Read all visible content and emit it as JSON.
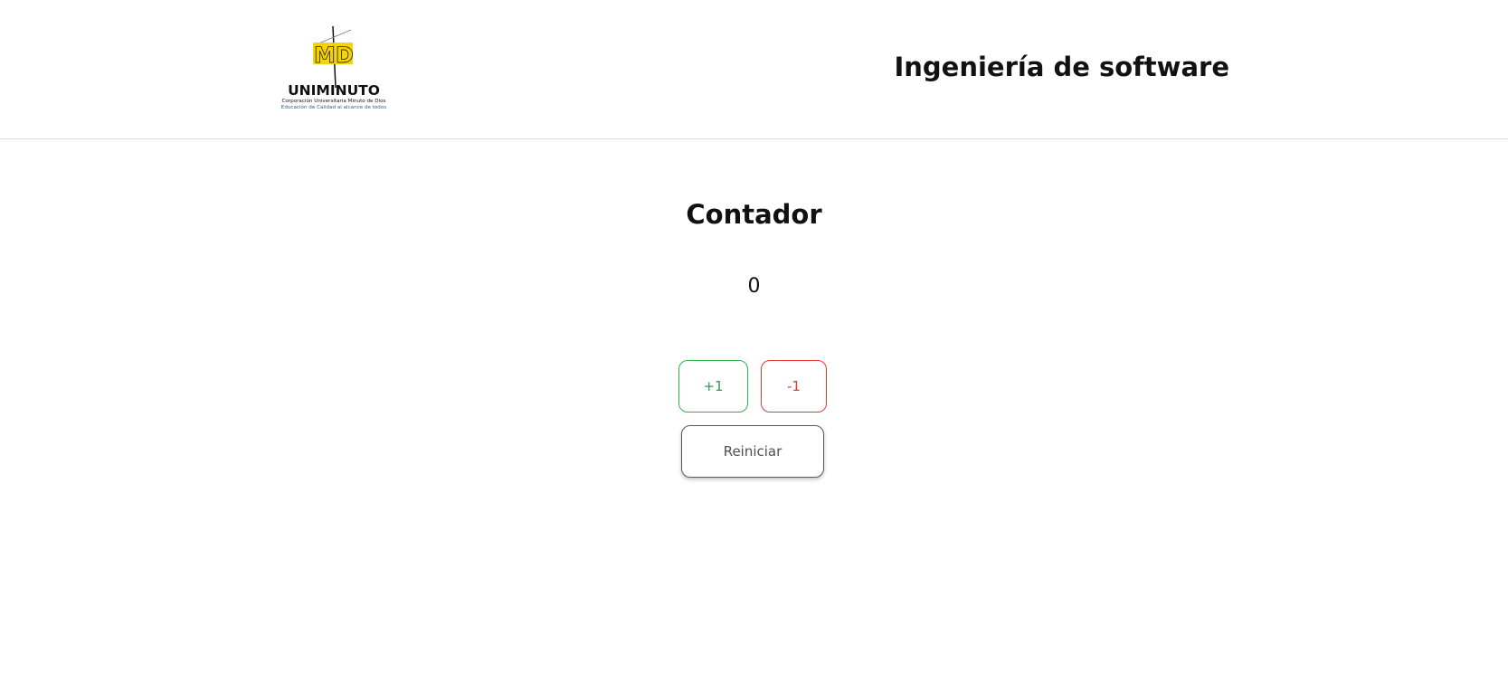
{
  "header": {
    "logo": {
      "brand_text": "UNIMINUTO",
      "line1": "Corporación Universitaria Minuto de Dios",
      "line2": "Educación de Calidad al alcance de todos",
      "monogram": "MD"
    },
    "title": "Ingeniería de software"
  },
  "counter": {
    "title": "Contador",
    "value": "0",
    "increment_label": "+1",
    "decrement_label": "-1",
    "reset_label": "Reiniciar"
  },
  "colors": {
    "increment": "#2eb34f",
    "decrement": "#e53935",
    "reset": "#555b63",
    "logo_yellow": "#f2d200",
    "logo_blue": "#1f5fa8"
  }
}
